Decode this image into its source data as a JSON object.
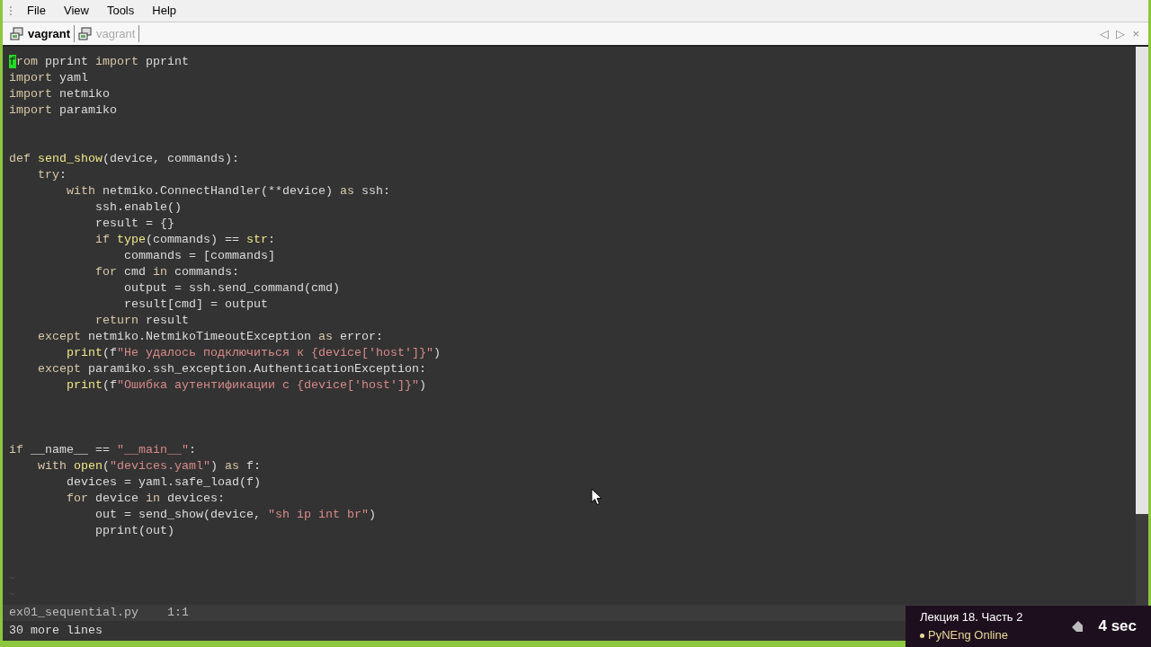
{
  "menu": [
    "File",
    "View",
    "Tools",
    "Help"
  ],
  "tabs": [
    {
      "label": "vagrant",
      "selected": true
    },
    {
      "label": "vagrant",
      "selected": false
    }
  ],
  "tab_controls": [
    "◁",
    "▷",
    "×"
  ],
  "code_lines": [
    {
      "kind": "code",
      "tokens": [
        {
          "kind": "cursor",
          "text": "f"
        },
        {
          "kind": "kw",
          "text": "rom"
        },
        {
          "kind": "text",
          "text": " pprint "
        },
        {
          "kind": "kw",
          "text": "import"
        },
        {
          "kind": "text",
          "text": " pprint"
        }
      ]
    },
    {
      "kind": "code",
      "tokens": [
        {
          "kind": "kw",
          "text": "import"
        },
        {
          "kind": "text",
          "text": " yaml"
        }
      ]
    },
    {
      "kind": "code",
      "tokens": [
        {
          "kind": "kw",
          "text": "import"
        },
        {
          "kind": "text",
          "text": " netmiko"
        }
      ]
    },
    {
      "kind": "code",
      "tokens": [
        {
          "kind": "kw",
          "text": "import"
        },
        {
          "kind": "text",
          "text": " paramiko"
        }
      ]
    },
    {
      "kind": "blank"
    },
    {
      "kind": "blank"
    },
    {
      "kind": "code",
      "tokens": [
        {
          "kind": "kw",
          "text": "def"
        },
        {
          "kind": "fn",
          "text": " send_show"
        },
        {
          "kind": "text",
          "text": "(device, commands):"
        }
      ]
    },
    {
      "kind": "code",
      "tokens": [
        {
          "kind": "kw",
          "text": "    try"
        },
        {
          "kind": "text",
          "text": ":"
        }
      ]
    },
    {
      "kind": "code",
      "tokens": [
        {
          "kind": "kw",
          "text": "        with"
        },
        {
          "kind": "text",
          "text": " netmiko.ConnectHandler(**device) "
        },
        {
          "kind": "kw",
          "text": "as"
        },
        {
          "kind": "text",
          "text": " ssh:"
        }
      ]
    },
    {
      "kind": "code",
      "tokens": [
        {
          "kind": "text",
          "text": "            ssh.enable()"
        }
      ]
    },
    {
      "kind": "code",
      "tokens": [
        {
          "kind": "text",
          "text": "            result = {}"
        }
      ]
    },
    {
      "kind": "code",
      "tokens": [
        {
          "kind": "kw",
          "text": "            if"
        },
        {
          "kind": "fn",
          "text": " type"
        },
        {
          "kind": "text",
          "text": "(commands) == "
        },
        {
          "kind": "fn",
          "text": "str"
        },
        {
          "kind": "text",
          "text": ":"
        }
      ]
    },
    {
      "kind": "code",
      "tokens": [
        {
          "kind": "text",
          "text": "                commands = [commands]"
        }
      ]
    },
    {
      "kind": "code",
      "tokens": [
        {
          "kind": "kw",
          "text": "            for"
        },
        {
          "kind": "text",
          "text": " cmd "
        },
        {
          "kind": "kw",
          "text": "in"
        },
        {
          "kind": "text",
          "text": " commands:"
        }
      ]
    },
    {
      "kind": "code",
      "tokens": [
        {
          "kind": "text",
          "text": "                output = ssh.send_command(cmd)"
        }
      ]
    },
    {
      "kind": "code",
      "tokens": [
        {
          "kind": "text",
          "text": "                result[cmd] = output"
        }
      ]
    },
    {
      "kind": "code",
      "tokens": [
        {
          "kind": "kw",
          "text": "            return"
        },
        {
          "kind": "text",
          "text": " result"
        }
      ]
    },
    {
      "kind": "code",
      "tokens": [
        {
          "kind": "kw",
          "text": "    except"
        },
        {
          "kind": "text",
          "text": " netmiko.NetmikoTimeoutException "
        },
        {
          "kind": "kw",
          "text": "as"
        },
        {
          "kind": "text",
          "text": " error:"
        }
      ]
    },
    {
      "kind": "code",
      "tokens": [
        {
          "kind": "fn",
          "text": "        print"
        },
        {
          "kind": "text",
          "text": "(f"
        },
        {
          "kind": "str",
          "text": "\"Не удалось подключиться к {device['host']}\""
        },
        {
          "kind": "text",
          "text": ")"
        }
      ]
    },
    {
      "kind": "code",
      "tokens": [
        {
          "kind": "kw",
          "text": "    except"
        },
        {
          "kind": "text",
          "text": " paramiko.ssh_exception.AuthenticationException:"
        }
      ]
    },
    {
      "kind": "code",
      "tokens": [
        {
          "kind": "fn",
          "text": "        print"
        },
        {
          "kind": "text",
          "text": "(f"
        },
        {
          "kind": "str",
          "text": "\"Ошибка аутентификации с {device['host']}\""
        },
        {
          "kind": "text",
          "text": ")"
        }
      ]
    },
    {
      "kind": "blank"
    },
    {
      "kind": "blank"
    },
    {
      "kind": "blank"
    },
    {
      "kind": "code",
      "tokens": [
        {
          "kind": "kw",
          "text": "if"
        },
        {
          "kind": "text",
          "text": " __name__ == "
        },
        {
          "kind": "str",
          "text": "\"__main__\""
        },
        {
          "kind": "text",
          "text": ":"
        }
      ]
    },
    {
      "kind": "code",
      "tokens": [
        {
          "kind": "kw",
          "text": "    with"
        },
        {
          "kind": "fn",
          "text": " open"
        },
        {
          "kind": "text",
          "text": "("
        },
        {
          "kind": "str",
          "text": "\"devices.yaml\""
        },
        {
          "kind": "text",
          "text": ") "
        },
        {
          "kind": "kw",
          "text": "as"
        },
        {
          "kind": "text",
          "text": " f:"
        }
      ]
    },
    {
      "kind": "code",
      "tokens": [
        {
          "kind": "text",
          "text": "        devices = yaml.safe_load(f)"
        }
      ]
    },
    {
      "kind": "code",
      "tokens": [
        {
          "kind": "kw",
          "text": "        for"
        },
        {
          "kind": "text",
          "text": " device "
        },
        {
          "kind": "kw",
          "text": "in"
        },
        {
          "kind": "text",
          "text": " devices:"
        }
      ]
    },
    {
      "kind": "code",
      "tokens": [
        {
          "kind": "text",
          "text": "            out = send_show(device, "
        },
        {
          "kind": "str",
          "text": "\"sh ip int br\""
        },
        {
          "kind": "text",
          "text": ")"
        }
      ]
    },
    {
      "kind": "code",
      "tokens": [
        {
          "kind": "text",
          "text": "            pprint(out)"
        }
      ]
    },
    {
      "kind": "blank"
    },
    {
      "kind": "blank"
    },
    {
      "kind": "filler",
      "text": "~"
    },
    {
      "kind": "filler",
      "text": "~"
    }
  ],
  "status_bar": {
    "file": "ex01_sequential.py",
    "position": "1:1"
  },
  "message": "30 more lines",
  "video_overlay": {
    "title": "Лекция 18. Часть 2",
    "channel": "PyNEng Online",
    "time": "4 sec"
  }
}
